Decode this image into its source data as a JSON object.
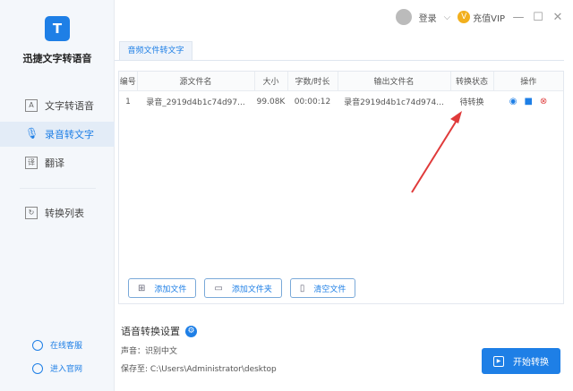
{
  "app": {
    "name": "迅捷文字转语音",
    "logo": "T"
  },
  "sidebar": {
    "items": [
      {
        "label": "文字转语音",
        "icon": "A"
      },
      {
        "label": "录音转文字",
        "icon": "🎙"
      },
      {
        "label": "翻译",
        "icon": "译"
      },
      {
        "label": "转换列表",
        "icon": "↻"
      }
    ],
    "footer": [
      {
        "label": "在线客服"
      },
      {
        "label": "进入官网"
      }
    ]
  },
  "topbar": {
    "login": "登录",
    "vip": "充值VIP",
    "vip_icon": "V"
  },
  "tab": "音频文件转文字",
  "table": {
    "headers": [
      "编号",
      "源文件名",
      "大小",
      "字数/时长",
      "输出文件名",
      "转换状态",
      "操作"
    ],
    "rows": [
      {
        "no": "1",
        "src": "录音_2919d4b1c74d97...",
        "size": "99.08K",
        "duration": "00:00:12",
        "out": "录音2919d4b1c74d974...",
        "status": "待转换"
      }
    ]
  },
  "buttons": {
    "add_file": "添加文件",
    "add_folder": "添加文件夹",
    "clear": "清空文件",
    "start": "开始转换"
  },
  "settings": {
    "title": "语音转换设置",
    "voice": "声音：识别中文",
    "save": "保存至: C:\\Users\\Administrator\\desktop"
  },
  "colors": {
    "accent": "#1e7fe6",
    "arrow": "#e03a3a"
  }
}
